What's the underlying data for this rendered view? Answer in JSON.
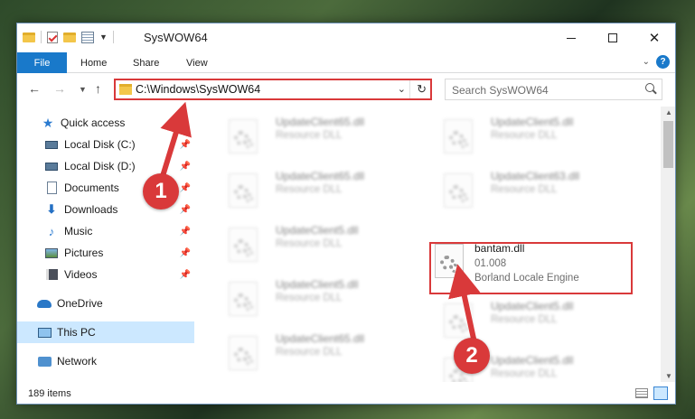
{
  "window": {
    "title": "SysWOW64"
  },
  "ribbon": {
    "file": "File",
    "home": "Home",
    "share": "Share",
    "view": "View"
  },
  "address": {
    "path": "C:\\Windows\\SysWOW64"
  },
  "search": {
    "placeholder": "Search SysWOW64"
  },
  "sidebar": {
    "items": [
      {
        "label": "Quick access",
        "icon": "star-icon"
      },
      {
        "label": "Local Disk (C:)",
        "icon": "disk-icon",
        "pinned": true
      },
      {
        "label": "Local Disk (D:)",
        "icon": "disk-icon",
        "pinned": true
      },
      {
        "label": "Documents",
        "icon": "documents-icon",
        "pinned": true
      },
      {
        "label": "Downloads",
        "icon": "download-icon",
        "pinned": true
      },
      {
        "label": "Music",
        "icon": "music-icon",
        "pinned": true
      },
      {
        "label": "Pictures",
        "icon": "pictures-icon",
        "pinned": true
      },
      {
        "label": "Videos",
        "icon": "videos-icon",
        "pinned": true
      },
      {
        "label": "OneDrive",
        "icon": "onedrive-icon"
      },
      {
        "label": "This PC",
        "icon": "pc-icon",
        "selected": true
      },
      {
        "label": "Network",
        "icon": "network-icon"
      }
    ]
  },
  "files": [
    {
      "name": "UpdateClient65.dll",
      "desc": "Resource DLL"
    },
    {
      "name": "UpdateClient5.dll",
      "desc": "Resource DLL"
    },
    {
      "name": "UpdateClient65.dll",
      "desc": "Resource DLL"
    },
    {
      "name": "UpdateClient63.dll",
      "desc": "Resource DLL"
    },
    {
      "name": "UpdateClient5.dll",
      "desc": "Resource DLL"
    },
    {
      "name": "bantam.dll",
      "version": "01.008",
      "desc": "Borland Locale Engine"
    },
    {
      "name": "UpdateClient5.dll",
      "desc": "Resource DLL"
    },
    {
      "name": "UpdateClient5.dll",
      "desc": "Resource DLL"
    },
    {
      "name": "UpdateClient65.dll",
      "desc": "Resource DLL"
    },
    {
      "name": "UpdateClient5.dll",
      "desc": "Resource DLL"
    }
  ],
  "status": {
    "count": "189 items"
  },
  "annotations": {
    "step1": "1",
    "step2": "2",
    "color": "#d9393a"
  }
}
